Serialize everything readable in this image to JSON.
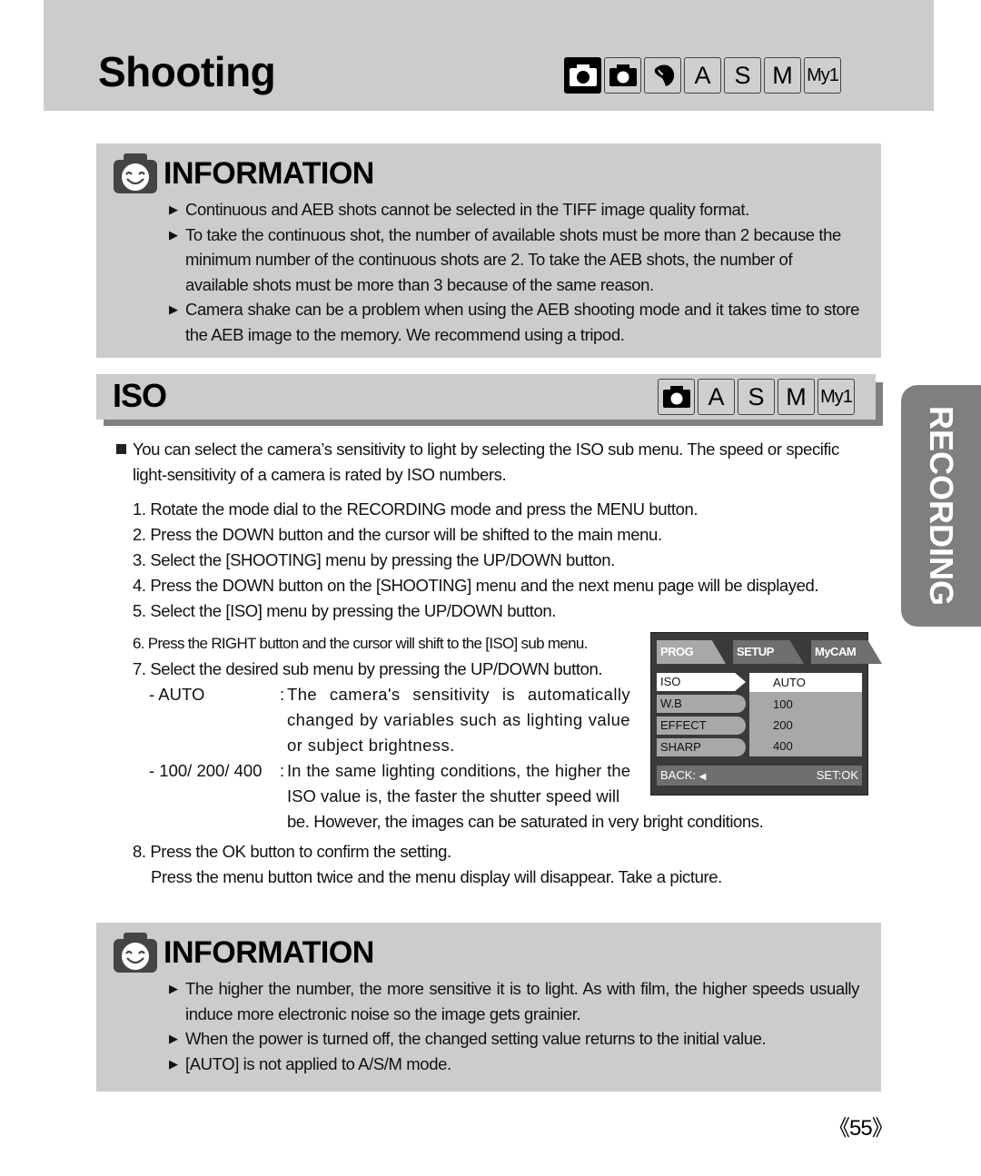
{
  "header": {
    "title": "Shooting",
    "mode_icons": [
      {
        "icon": "auto-camera-icon",
        "label": "",
        "active": true
      },
      {
        "icon": "program-camera-icon",
        "label": "",
        "active": false
      },
      {
        "icon": "portrait-scene-icon",
        "label": "",
        "active": false
      },
      {
        "icon": "aperture-priority",
        "label": "A",
        "active": false
      },
      {
        "icon": "shutter-priority",
        "label": "S",
        "active": false
      },
      {
        "icon": "manual-mode",
        "label": "M",
        "active": false
      },
      {
        "icon": "my-set-mode",
        "label": "My1",
        "active": false
      }
    ]
  },
  "info_top": {
    "title": "INFORMATION",
    "icon": "smiley-camera-icon",
    "bullets": [
      "Continuous and AEB shots cannot be selected in the TIFF image quality format.",
      "To take the continuous shot, the number of available shots must be more than 2 because the minimum number of the continuous shots are 2. To take the AEB shots, the number of available shots must be more than 3 because of the same reason.",
      "Camera shake can be a problem when using the AEB shooting mode and it takes time to store the AEB image to the memory. We recommend using a tripod."
    ]
  },
  "iso_section": {
    "title": "ISO",
    "mode_icons": [
      {
        "icon": "program-camera-icon",
        "label": ""
      },
      {
        "icon": "aperture-priority",
        "label": "A"
      },
      {
        "icon": "shutter-priority",
        "label": "S"
      },
      {
        "icon": "manual-mode",
        "label": "M"
      },
      {
        "icon": "my-set-mode",
        "label": "My1"
      }
    ],
    "intro_line1": "You can select the camera’s sensitivity to light by selecting the ISO sub menu. The speed or specific",
    "intro_line2": "light-sensitivity of a camera is rated by ISO numbers.",
    "steps": [
      "1. Rotate the mode dial to the RECORDING mode and press the MENU button.",
      "2. Press the DOWN button and the cursor will be shifted to the main menu.",
      "3. Select the [SHOOTING] menu by pressing the UP/DOWN button.",
      "4. Press the DOWN button on the [SHOOTING] menu and the next menu page will be displayed.",
      "5. Select the [ISO] menu by pressing the UP/DOWN button."
    ],
    "step6": "6. Press the RIGHT button and the cursor will shift to the [ISO] sub menu.",
    "step7": "7. Select the desired sub menu by pressing the UP/DOWN button.",
    "options": [
      {
        "label": "- AUTO",
        "desc": "The camera's sensitivity is automatically changed by variables such as lighting value or subject brightness."
      },
      {
        "label": "- 100/ 200/ 400",
        "desc": "In the same lighting conditions, the higher the ISO value is, the faster the shutter speed will",
        "desc_cont": "be. However, the images can be saturated in very bright conditions."
      }
    ],
    "step8": "8. Press the OK button to confirm the setting.",
    "step8_cont": "Press the menu button twice and the menu display will disappear. Take a picture."
  },
  "lcd_menu": {
    "tabs": [
      "PROG",
      "SETUP",
      "MyCAM"
    ],
    "active_tab": "PROG",
    "items": [
      "ISO",
      "W.B",
      "EFFECT",
      "SHARP"
    ],
    "selected_item": "ISO",
    "values": [
      "AUTO",
      "100",
      "200",
      "400"
    ],
    "selected_value": "AUTO",
    "back_label": "BACK:",
    "set_label": "SET:OK"
  },
  "side_tab": {
    "label": "RECORDING"
  },
  "info_bottom": {
    "title": "INFORMATION",
    "icon": "smiley-camera-icon",
    "bullets": [
      "The higher the number, the more sensitive it is to light. As with film, the higher speeds usually induce more electronic noise so the image gets grainier.",
      "When the power is turned off, the changed setting value returns to the initial value.",
      "[AUTO] is not applied to A/S/M mode."
    ]
  },
  "footer": {
    "page_number": "《55》"
  }
}
